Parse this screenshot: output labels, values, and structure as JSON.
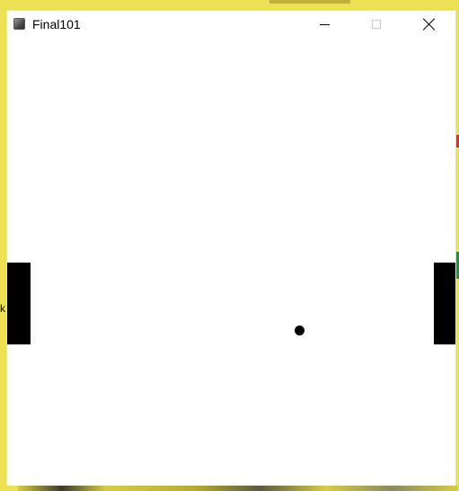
{
  "window": {
    "title": "Final101",
    "controls": {
      "minimize": "minimize",
      "maximize": "maximize",
      "close": "close"
    }
  },
  "desktop": {
    "left_edge_letter": "k"
  },
  "game": {
    "left_paddle_color": "#000000",
    "right_paddle_color": "#000000",
    "ball_color": "#000000",
    "background_color": "#ffffff"
  },
  "theme": {
    "window_border": "#f2e978",
    "desktop_accent": "#ece055"
  }
}
